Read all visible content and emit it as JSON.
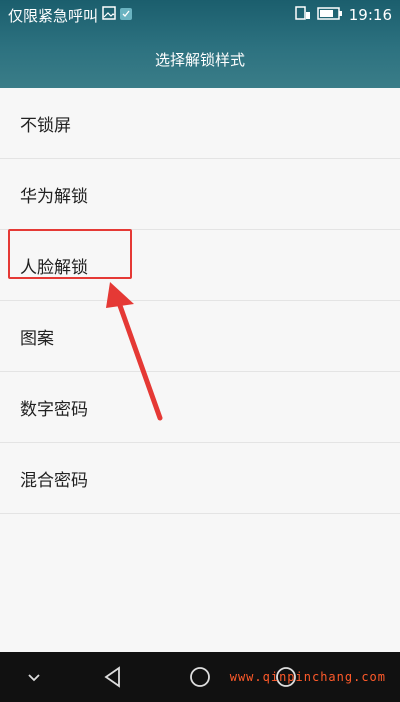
{
  "status_bar": {
    "carrier_text": "仅限紧急呼叫",
    "time": "19:16"
  },
  "header": {
    "title": "选择解锁样式"
  },
  "lock_options": [
    {
      "label": "不锁屏"
    },
    {
      "label": "华为解锁"
    },
    {
      "label": "人脸解锁"
    },
    {
      "label": "图案"
    },
    {
      "label": "数字密码"
    },
    {
      "label": "混合密码"
    }
  ],
  "highlighted_option": "人脸解锁",
  "navigation_bar": {
    "icons": [
      "chevron-down-icon",
      "back-icon",
      "home-icon",
      "recent-apps-icon"
    ]
  },
  "watermark": "www.qinpinchang.com",
  "colors": {
    "header": "#2d7280",
    "highlight_border": "#e53935",
    "arrow": "#e53935"
  }
}
